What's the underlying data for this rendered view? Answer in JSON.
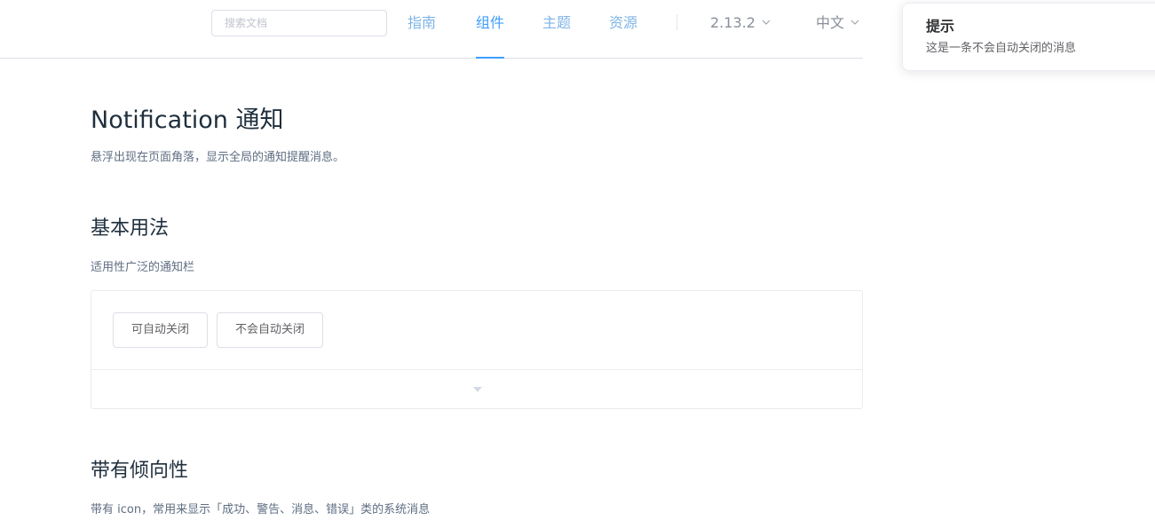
{
  "header": {
    "search_placeholder": "搜索文档",
    "nav": [
      {
        "label": "指南",
        "active": false
      },
      {
        "label": "组件",
        "active": true
      },
      {
        "label": "主题",
        "active": false
      },
      {
        "label": "资源",
        "active": false
      }
    ],
    "version": "2.13.2",
    "language": "中文"
  },
  "notification": {
    "title": "提示",
    "message": "这是一条不会自动关闭的消息"
  },
  "main": {
    "title": "Notification 通知",
    "description": "悬浮出现在页面角落，显示全局的通知提醒消息。",
    "sections": [
      {
        "title": "基本用法",
        "description": "适用性广泛的通知栏",
        "buttons": [
          "可自动关闭",
          "不会自动关闭"
        ]
      },
      {
        "title": "带有倾向性",
        "description": "带有 icon，常用来显示「成功、警告、消息、错误」类的系统消息"
      }
    ]
  },
  "colors": {
    "accent": "#409eff",
    "nav_inactive": "#7fb4e6",
    "text_primary": "#1f2f3d",
    "text_secondary": "#5e6d82"
  }
}
